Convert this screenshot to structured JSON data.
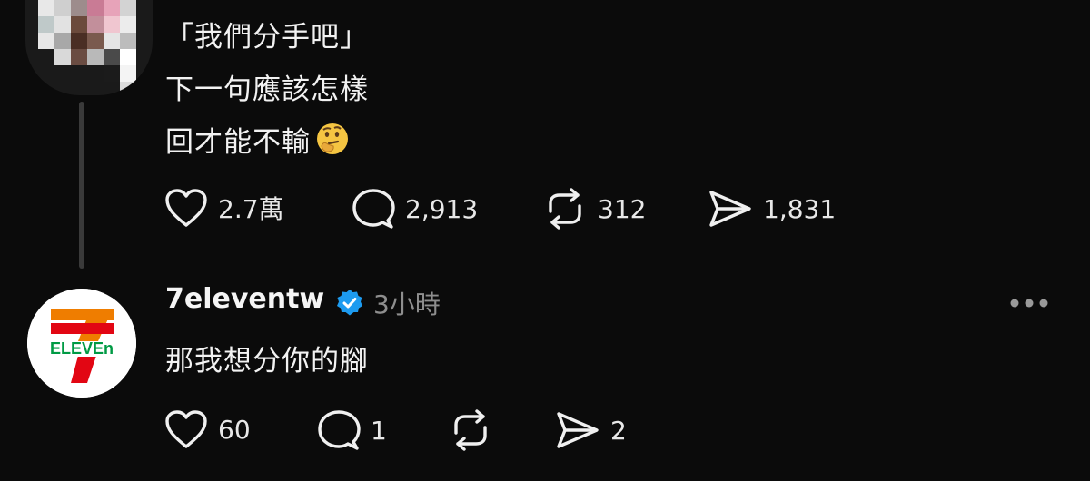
{
  "post1": {
    "lines": [
      "「我們分手吧」",
      "下一句應該怎樣",
      "回才能不輸"
    ],
    "emoji": "thinking-face",
    "stats": {
      "likes": "2.7萬",
      "comments": "2,913",
      "reposts": "312",
      "shares": "1,831"
    }
  },
  "reply": {
    "username": "7eleventw",
    "verified": true,
    "time": "3小時",
    "text": "那我想分你的腳",
    "avatar_brand": "ELEVEn",
    "stats": {
      "likes": "60",
      "comments": "1",
      "reposts": "",
      "shares": "2"
    }
  },
  "colors": {
    "background": "#0b0b0b",
    "verified": "#1d9bf0",
    "muted": "#8e8e8e"
  }
}
